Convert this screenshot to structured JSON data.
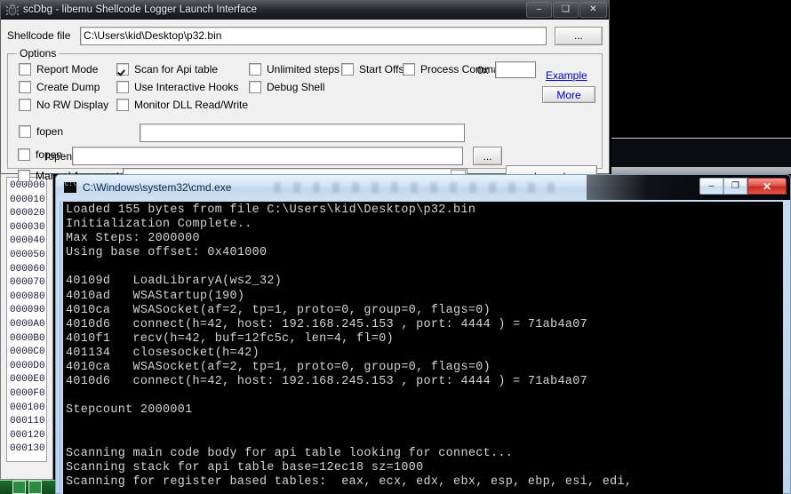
{
  "desktop": {
    "background_color": "#000000"
  },
  "scdbg_window": {
    "title": "scDbg - libemu Shellcode Logger Launch Interface",
    "icon": "bug-icon",
    "titlebar_buttons": [
      {
        "name": "minimize",
        "glyph": "–"
      },
      {
        "name": "maximize",
        "glyph": "❑"
      },
      {
        "name": "close",
        "glyph": "✕"
      }
    ],
    "shellcode_file": {
      "label": "Shellcode file",
      "value": "C:\\Users\\kid\\Desktop\\p32.bin",
      "placeholder": "",
      "browse_label": "..."
    },
    "options": {
      "legend": "Options",
      "checkboxes": [
        {
          "label": "Report Mode",
          "checked": false
        },
        {
          "label": "Create Dump",
          "checked": false
        },
        {
          "label": "No RW Display",
          "checked": false
        },
        {
          "label": "Scan for Api table",
          "checked": true
        },
        {
          "label": "Use Interactive Hooks",
          "checked": false
        },
        {
          "label": "Monitor DLL Read/Write",
          "checked": false
        },
        {
          "label": "Unlimited steps",
          "checked": false
        },
        {
          "label": "Debug Shell",
          "checked": false
        },
        {
          "label": "Start Offset",
          "checked": false
        },
        {
          "label": "Process Command Line",
          "checked": false
        },
        {
          "label": "fopen",
          "checked": false
        },
        {
          "label": "Manual  Arguments",
          "checked": false
        }
      ],
      "start_offset_prefix": "0x",
      "start_offset_value": "",
      "example_link": "Example",
      "more_button": "More",
      "process_command_line_value": "",
      "fopen_value": "",
      "fopen_browse_label": "...",
      "manual_arguments_value": "",
      "launch_button": "Launch"
    }
  },
  "hex_window": {
    "offsets": [
      "000000",
      "000010",
      "000020",
      "000030",
      "000040",
      "000050",
      "000060",
      "000070",
      "000080",
      "000090",
      "0000A0",
      "0000B0",
      "0000C0",
      "0000D0",
      "0000E0",
      "0000F0",
      "000100",
      "000110",
      "000120",
      "000130"
    ]
  },
  "taskbar": {
    "icons": [
      "green-app-icon",
      "green-arrow-icon"
    ]
  },
  "cmd_window": {
    "title": "C:\\Windows\\system32\\cmd.exe",
    "icon": "console-icon",
    "titlebar_buttons": [
      {
        "name": "minimize",
        "glyph": "–"
      },
      {
        "name": "maximize",
        "glyph": "❐"
      },
      {
        "name": "close",
        "glyph": "✕"
      }
    ],
    "console_output": "Loaded 155 bytes from file C:\\Users\\kid\\Desktop\\p32.bin\nInitialization Complete..\nMax Steps: 2000000\nUsing base offset: 0x401000\n\n40109d   LoadLibraryA(ws2_32)\n4010ad   WSAStartup(190)\n4010ca   WSASocket(af=2, tp=1, proto=0, group=0, flags=0)\n4010d6   connect(h=42, host: 192.168.245.153 , port: 4444 ) = 71ab4a07\n4010f1   recv(h=42, buf=12fc5c, len=4, fl=0)\n401134   closesocket(h=42)\n4010ca   WSASocket(af=2, tp=1, proto=0, group=0, flags=0)\n4010d6   connect(h=42, host: 192.168.245.153 , port: 4444 ) = 71ab4a07\n\nStepcount 2000001\n\n\nScanning main code body for api table looking for connect...\nScanning stack for api table base=12ec18 sz=1000\nScanning for register based tables:  eax, ecx, edx, ebx, esp, ebp, esi, edi,"
  },
  "colors": {
    "window_face": "#f0f0f0",
    "console_bg": "#000000",
    "console_fg": "#d4d4d4",
    "link": "#0000d6",
    "aero_border": "#bcd4ea",
    "close_red": "#c72a1f"
  }
}
